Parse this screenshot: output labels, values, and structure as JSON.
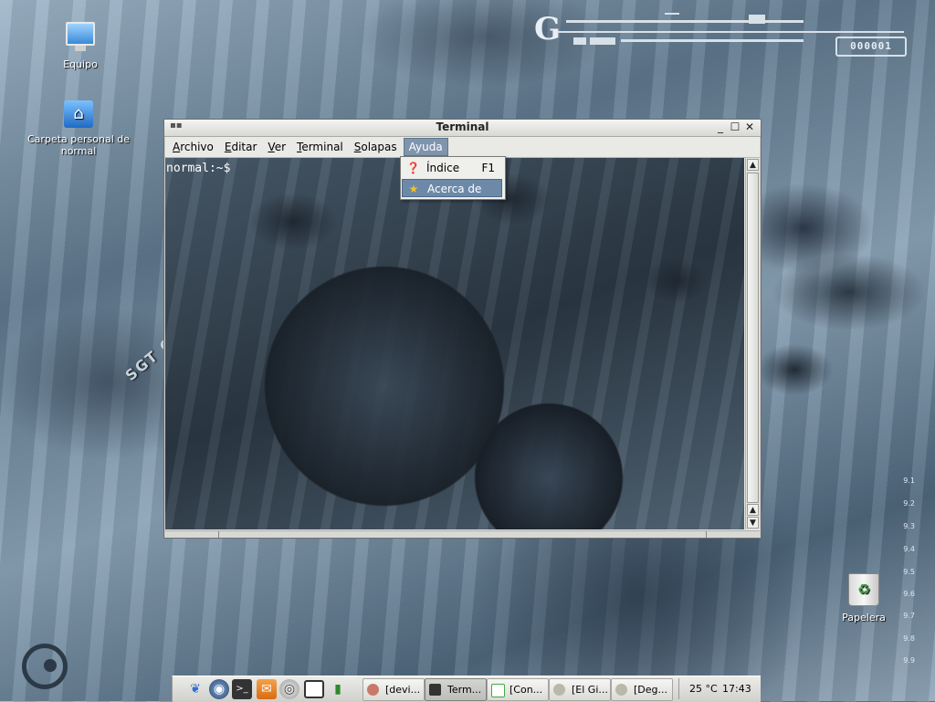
{
  "desktop": {
    "icons": [
      {
        "label": "Equipo",
        "icon": "computer-icon"
      },
      {
        "label": "Carpeta personal de normal",
        "icon": "home-folder-icon"
      },
      {
        "label": "Papelera",
        "icon": "trash-icon"
      }
    ],
    "wallpaper_text": "SGT CREATIONS",
    "hud_counter": "000001",
    "scale_labels": [
      "9.1",
      "9.2",
      "9.3",
      "9.4",
      "9.5",
      "9.6",
      "9.7",
      "9.8",
      "9.9"
    ]
  },
  "window": {
    "title": "Terminal",
    "controls": {
      "minimize": "_",
      "maximize": "☐",
      "close": "✕"
    },
    "menu": [
      {
        "label": "Archivo",
        "mnemonic": "A"
      },
      {
        "label": "Editar",
        "mnemonic": "E"
      },
      {
        "label": "Ver",
        "mnemonic": "V"
      },
      {
        "label": "Terminal",
        "mnemonic": "T"
      },
      {
        "label": "Solapas",
        "mnemonic": "S"
      },
      {
        "label": "Ayuda",
        "mnemonic": "y",
        "active": true
      }
    ],
    "terminal": {
      "prompt": "normal:~$"
    }
  },
  "dropdown": {
    "items": [
      {
        "label": "Índice",
        "shortcut": "F1",
        "icon": "help-icon"
      },
      {
        "label": "Acerca de",
        "shortcut": "",
        "icon": "about-star-icon",
        "highlighted": true
      }
    ]
  },
  "taskbar": {
    "launchers": [
      "gnome-foot-icon",
      "web-browser-icon",
      "terminal-launcher-icon",
      "mail-icon",
      "media-player-icon",
      "screen-icon",
      "network-icon"
    ],
    "tasks": [
      {
        "label": "[devi...",
        "icon": "brain-icon"
      },
      {
        "label": "Term...",
        "icon": "terminal-icon",
        "active": true
      },
      {
        "label": "[Con...",
        "icon": "document-icon"
      },
      {
        "label": "[El Gi...",
        "icon": "gecko-icon"
      },
      {
        "label": "[Deg...",
        "icon": "gecko-icon"
      }
    ],
    "weather": "25 °C",
    "clock": "17:43"
  },
  "colors": {
    "menu_highlight": "#7f95ad",
    "dropdown_highlight": "#6d89a8",
    "window_bg": "#e9e9e6"
  }
}
